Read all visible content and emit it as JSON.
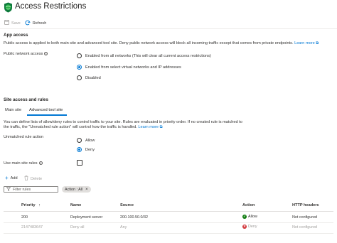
{
  "header": {
    "title": "Access Restrictions",
    "more": "···"
  },
  "toolbar": {
    "save_label": "Save",
    "refresh_label": "Refresh"
  },
  "app_access": {
    "heading": "App access",
    "description": "Public access is applied to both main site and advanced tool site. Deny public network access will block all incoming traffic except that comes from private endpoints.",
    "learn_more": "Learn more",
    "public_network_access_label": "Public network access",
    "options": [
      "Enabled from all networks (This will clear all current access restrictions)",
      "Enabled from select virtual networks and IP addresses",
      "Disabled"
    ],
    "selected_index": 1
  },
  "site_rules": {
    "heading": "Site access and rules",
    "tabs": [
      "Main site",
      "Advanced tool site"
    ],
    "active_tab": 1,
    "description_line1": "You can define lists of allow/deny rules to control traffic to your site. Rules are evaluated in priority order. If no created rule is matched to",
    "description_line2": "the traffic, the \"Unmatched rule action\" will control how the traffic is handled.",
    "learn_more": "Learn more",
    "unmatched_label": "Unmatched rule action",
    "unmatched_options": [
      "Allow",
      "Deny"
    ],
    "unmatched_selected_index": 1,
    "use_main_site_label": "Use main site rules",
    "add_label": "Add",
    "delete_label": "Delete",
    "filter_placeholder": "Filter rules",
    "action_pill": "Action : All",
    "columns": [
      "Priority",
      "Name",
      "Source",
      "Action",
      "HTTP headers"
    ],
    "priority_sort": "↑",
    "rows": [
      {
        "priority": "200",
        "name": "Deployment server",
        "source": "200.100.50.0/32",
        "action": "Allow",
        "headers": "Not configured"
      },
      {
        "priority": "2147483647",
        "name": "Deny all",
        "source": "Any",
        "action": "Deny",
        "headers": "Not configured"
      }
    ]
  },
  "colors": {
    "accent": "#0078d4",
    "allow": "#107c10",
    "deny": "#d13438"
  }
}
